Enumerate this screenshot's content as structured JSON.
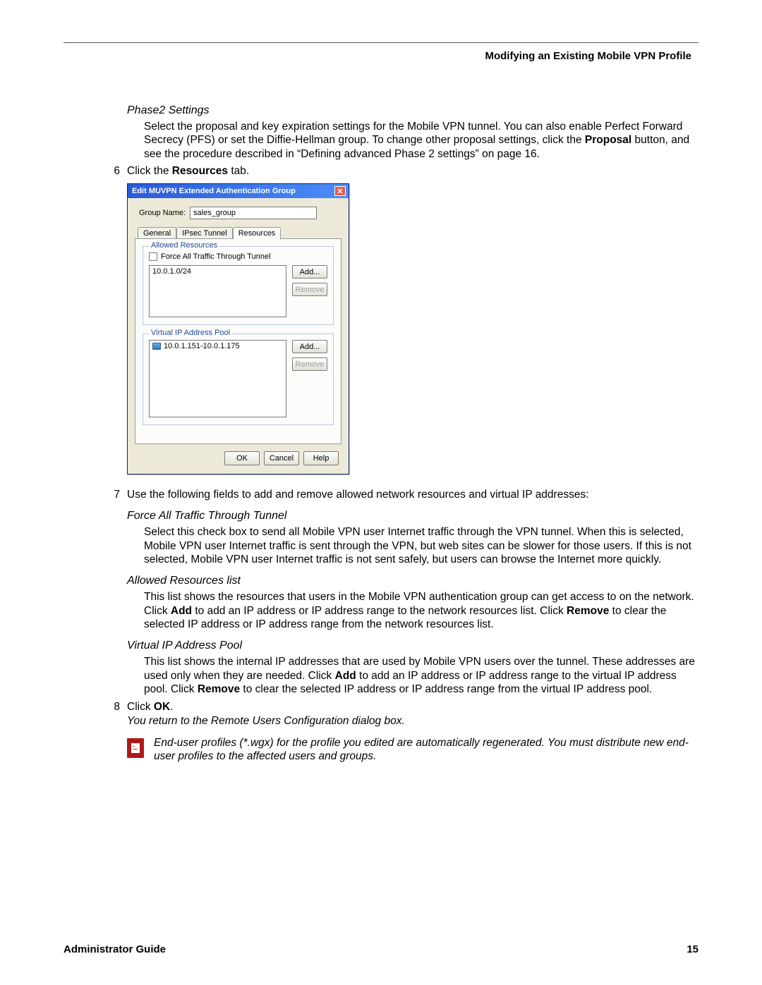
{
  "header": {
    "right": "Modifying an Existing Mobile VPN Profile"
  },
  "phase2": {
    "heading": "Phase2 Settings",
    "body_parts": [
      "Select the proposal and key expiration settings for the Mobile VPN tunnel. You can also enable Perfect Forward Secrecy (PFS) or set the Diffie-Hellman group. To change other proposal settings, click the ",
      "Proposal",
      " button, and see the procedure described in “Defining advanced Phase 2 settings” on page 16."
    ]
  },
  "steps": {
    "s6": {
      "num": "6",
      "prefix": "Click the ",
      "bold": "Resources",
      "suffix": " tab."
    },
    "s7": {
      "num": "7",
      "text": "Use the following fields to add and remove allowed network resources and virtual IP addresses:"
    },
    "s8": {
      "num": "8",
      "prefix": "Click ",
      "bold": "OK",
      "suffix": "."
    },
    "s8_after": "You return to the Remote Users Configuration dialog box."
  },
  "dialog": {
    "title": "Edit MUVPN Extended Authentication Group",
    "group_name_label": "Group Name:",
    "group_name_value": "sales_group",
    "tabs": {
      "general": "General",
      "ipsec": "IPsec Tunnel",
      "resources": "Resources"
    },
    "allowed": {
      "legend": "Allowed Resources",
      "force_label": "Force All Traffic Through Tunnel",
      "list_item": "10.0.1.0/24",
      "add": "Add...",
      "remove": "Remove"
    },
    "pool": {
      "legend": "Virtual IP Address Pool",
      "list_item": "10.0.1.151-10.0.1.175",
      "add": "Add...",
      "remove": "Remove"
    },
    "buttons": {
      "ok": "OK",
      "cancel": "Cancel",
      "help": "Help"
    }
  },
  "force_tunnel": {
    "heading": "Force All Traffic Through Tunnel",
    "body": "Select this check box to send all Mobile VPN user Internet traffic through the VPN tunnel. When this is selected, Mobile VPN user Internet traffic is sent through the VPN, but web sites can be slower for those users. If this is not selected, Mobile VPN user Internet traffic is not sent safely, but users can browse the Internet more quickly."
  },
  "allowed_list": {
    "heading": "Allowed Resources list",
    "parts": [
      "This list shows the resources that users in the Mobile VPN authentication group can get access to on the network. Click ",
      "Add",
      " to add an IP address or IP address range to the network resources list. Click ",
      "Remove",
      " to clear the selected IP address or IP address range from the network resources list."
    ]
  },
  "vip_pool": {
    "heading": "Virtual IP Address Pool",
    "parts": [
      "This list shows the internal IP addresses that are used by Mobile VPN users over the tunnel. These addresses are used only when they are needed. Click ",
      "Add",
      " to add an IP address or IP address range to the virtual IP address pool. Click ",
      "Remove",
      " to clear the selected IP address or IP address range from the virtual IP address pool."
    ]
  },
  "note": "End-user profiles (*.wgx) for the profile you edited are automatically regenerated. You must distribute new end-user profiles to the affected users and groups.",
  "footer": {
    "left": "Administrator Guide",
    "right": "15"
  }
}
